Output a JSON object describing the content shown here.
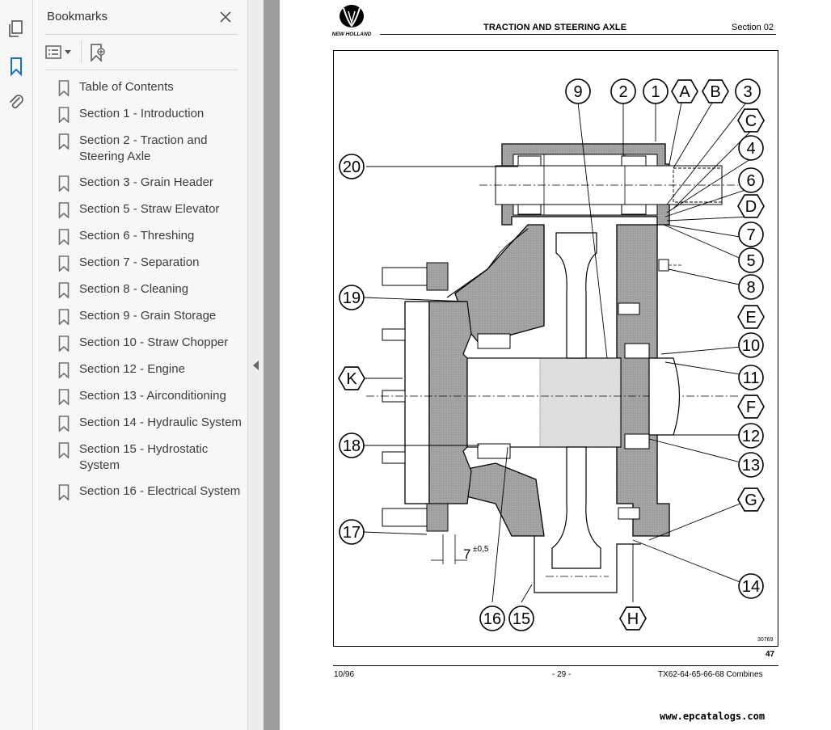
{
  "sidebar_rail": {
    "icons": [
      "pages-icon",
      "bookmark-icon",
      "attachment-icon"
    ]
  },
  "bookmarks_panel": {
    "title": "Bookmarks",
    "items": [
      {
        "label": "Table of Contents"
      },
      {
        "label": "Section 1 - Introduction"
      },
      {
        "label": "Section 2 - Traction and Steering Axle"
      },
      {
        "label": "Section 3 - Grain Header"
      },
      {
        "label": "Section 5 - Straw Elevator"
      },
      {
        "label": "Section 6 - Threshing"
      },
      {
        "label": "Section 7 - Separation"
      },
      {
        "label": "Section 8 - Cleaning"
      },
      {
        "label": "Section 9 - Grain Storage"
      },
      {
        "label": "Section 10 - Straw Chopper"
      },
      {
        "label": "Section 12 - Engine"
      },
      {
        "label": "Section 13 - Airconditioning"
      },
      {
        "label": "Section 14 - Hydraulic System"
      },
      {
        "label": "Section 15 - Hydrostatic System"
      },
      {
        "label": "Section 16 - Electrical System"
      }
    ]
  },
  "document": {
    "logo_text": "NEW HOLLAND",
    "header_title": "TRACTION AND STEERING AXLE",
    "header_section": "Section 02",
    "figure": {
      "callouts_circle": [
        "1",
        "2",
        "3",
        "4",
        "5",
        "6",
        "7",
        "8",
        "9",
        "10",
        "11",
        "12",
        "13",
        "14",
        "15",
        "16",
        "17",
        "18",
        "19",
        "20"
      ],
      "callouts_hex": [
        "A",
        "B",
        "C",
        "D",
        "E",
        "F",
        "G",
        "H",
        "K"
      ],
      "dimension_label": "7",
      "dimension_tolerance": "±0,5",
      "drawing_id": "30769"
    },
    "figure_number": "47",
    "footer_date": "10/96",
    "footer_page": "- 29 -",
    "footer_model": "TX62-64-65-66-68 Combines"
  },
  "watermark": "www.epcatalogs.com",
  "colors": {
    "panel_bg": "#f7f7f7",
    "accent_blue": "#1a6fc9",
    "gutter": "#ececec",
    "dark_strip": "#9e9e9e",
    "hatch_gray": "#a8a8a8"
  }
}
